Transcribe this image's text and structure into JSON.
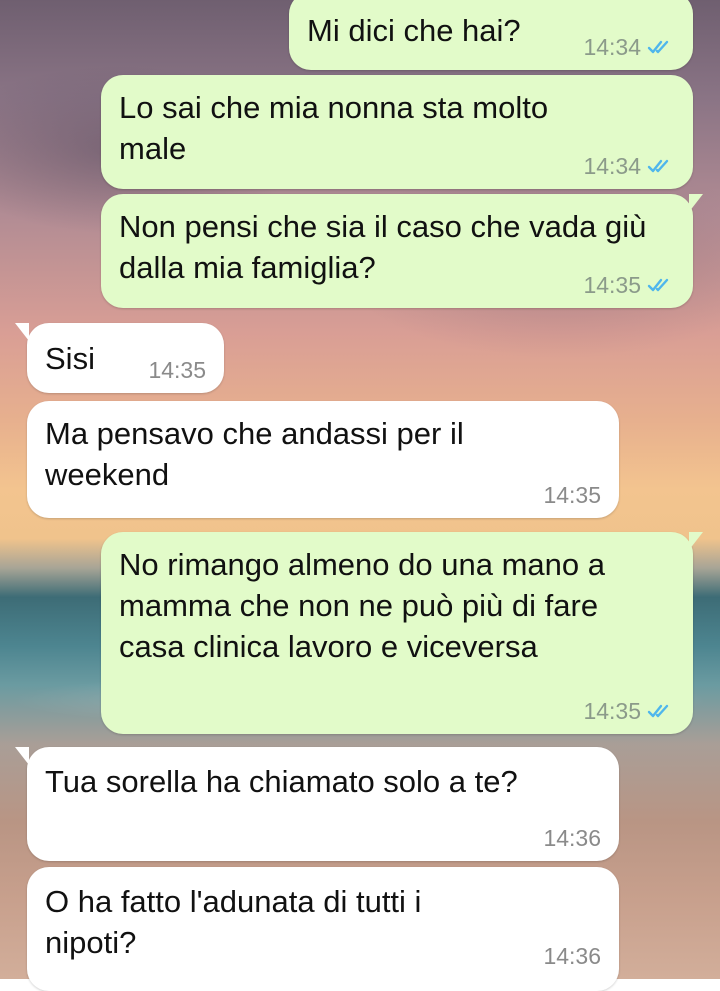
{
  "messages": [
    {
      "dir": "out",
      "text": "Mi dici che hai?",
      "time": "14:34",
      "ticks": "read-double-check-icon"
    },
    {
      "dir": "out",
      "text": "Lo sai che mia nonna sta molto male",
      "time": "14:34",
      "ticks": "read-double-check-icon"
    },
    {
      "dir": "out",
      "text": "Non pensi che sia il caso che vada giù dalla mia famiglia?",
      "time": "14:35",
      "ticks": "read-double-check-icon"
    },
    {
      "dir": "in",
      "text": "Sisi",
      "time": "14:35"
    },
    {
      "dir": "in",
      "text": "Ma pensavo che andassi per il weekend",
      "time": "14:35"
    },
    {
      "dir": "out",
      "text": "No rimango almeno do una mano a mamma che non ne può più di fare casa clinica lavoro e viceversa",
      "time": "14:35",
      "ticks": "read-double-check-icon"
    },
    {
      "dir": "in",
      "text": "Tua sorella ha chiamato solo a te?",
      "time": "14:36"
    },
    {
      "dir": "in",
      "text": "O ha fatto l'adunata di tutti i nipoti?",
      "time": "14:36"
    }
  ],
  "colors": {
    "outgoing_bubble": "#e2fbc9",
    "incoming_bubble": "#ffffff",
    "read_ticks": "#4fb6ec"
  }
}
